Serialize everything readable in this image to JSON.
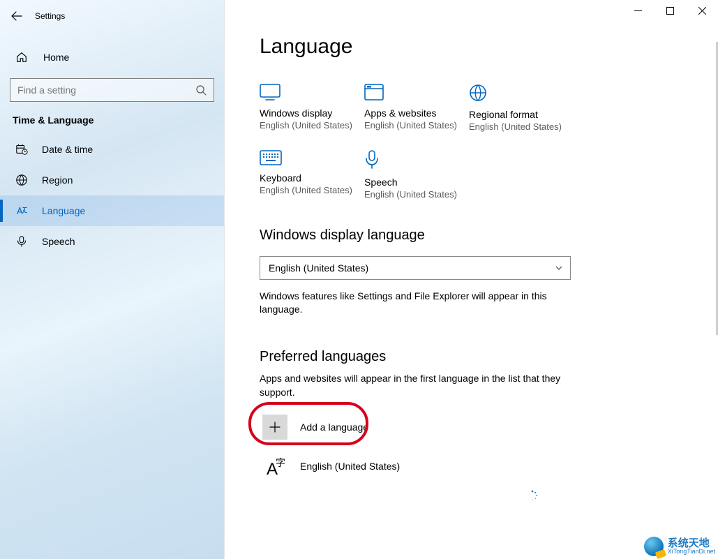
{
  "titlebar": {
    "title": "Settings"
  },
  "sidebar": {
    "home": "Home",
    "search_placeholder": "Find a setting",
    "section": "Time & Language",
    "items": [
      {
        "label": "Date & time"
      },
      {
        "label": "Region"
      },
      {
        "label": "Language"
      },
      {
        "label": "Speech"
      }
    ]
  },
  "main": {
    "heading": "Language",
    "tiles": [
      {
        "title": "Windows display",
        "sub": "English (United States)"
      },
      {
        "title": "Apps & websites",
        "sub": "English (United States)"
      },
      {
        "title": "Regional format",
        "sub": "English (United States)"
      },
      {
        "title": "Keyboard",
        "sub": "English (United States)"
      },
      {
        "title": "Speech",
        "sub": "English (United States)"
      }
    ],
    "display_lang": {
      "heading": "Windows display language",
      "selected": "English (United States)",
      "help": "Windows features like Settings and File Explorer will appear in this language."
    },
    "preferred": {
      "heading": "Preferred languages",
      "help": "Apps and websites will appear in the first language in the list that they support.",
      "add_label": "Add a language",
      "list": [
        {
          "label": "English (United States)"
        }
      ]
    }
  },
  "watermark": {
    "line1": "系统天地",
    "line2": "XiTongTianDi.net"
  }
}
